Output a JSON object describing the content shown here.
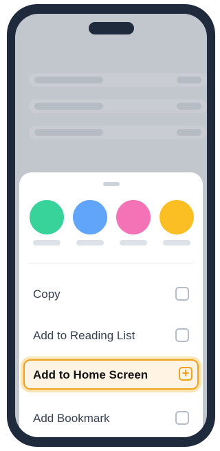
{
  "share_sheet": {
    "apps": [
      {
        "icon": "green-circle-icon",
        "color": "#37d39a"
      },
      {
        "icon": "blue-circle-icon",
        "color": "#60a5fa"
      },
      {
        "icon": "pink-circle-icon",
        "color": "#f472b6"
      },
      {
        "icon": "yellow-circle-icon",
        "color": "#fbbf24"
      }
    ],
    "actions": [
      {
        "label": "Copy",
        "icon": "checkbox-icon"
      },
      {
        "label": "Add to Reading List",
        "icon": "checkbox-icon"
      },
      {
        "label": "Add to Home Screen",
        "icon": "plus-square-icon",
        "highlighted": true
      },
      {
        "label": "Add Bookmark",
        "icon": "checkbox-icon"
      }
    ]
  },
  "colors": {
    "phone_frame": "#1f2a3d",
    "dimmed_background": "#c2c7ce",
    "highlight_accent": "#f0a21d",
    "highlight_fill": "#fff3e4"
  }
}
